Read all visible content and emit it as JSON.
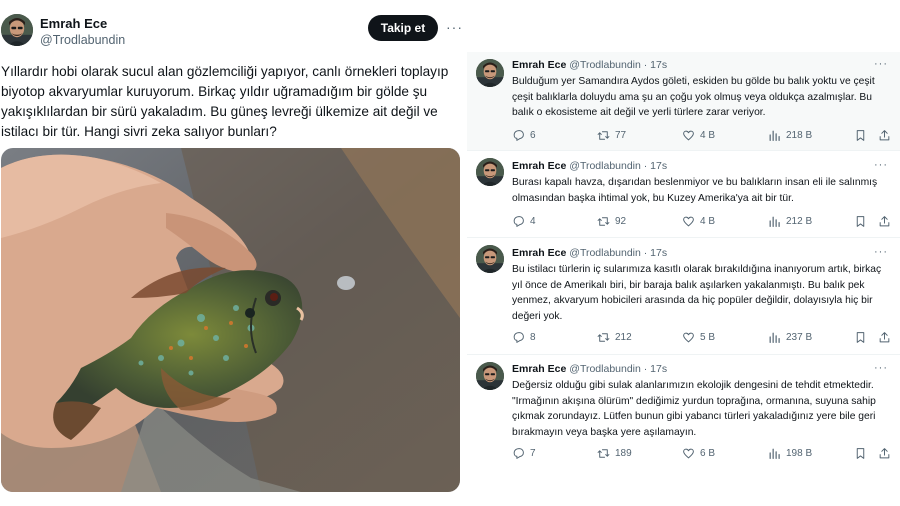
{
  "main_tweet": {
    "name": "Emrah Ece",
    "handle": "@Trodlabundin",
    "follow_label": "Takip et",
    "more": "···",
    "text": "Yıllardır hobi olarak sucul alan gözlemciliği yapıyor, canlı örnekleri toplayıp biyotop akvaryumlar kuruyorum. Birkaç yıldır uğramadığım bir gölde şu yakışıklılardan bir sürü yakaladım. Bu güneş levreği ülkemize ait değil ve istilacı bir tür. Hangi sivri zeka salıyor bunları?"
  },
  "replies": [
    {
      "name": "Emrah Ece",
      "handle": "@Trodlabundin",
      "time": "· 17s",
      "text": "Bulduğum yer Samandıra Aydos göleti, eskiden bu gölde bu balık yoktu ve çeşit çeşit balıklarla doluydu ama şu an çoğu yok olmuş veya oldukça azalmışlar. Bu balık o ekosisteme ait değil ve yerli türlere zarar veriyor.",
      "replies": "6",
      "retweets": "77",
      "likes": "4 B",
      "views": "218 B"
    },
    {
      "name": "Emrah Ece",
      "handle": "@Trodlabundin",
      "time": "· 17s",
      "text": "Burası kapalı havza, dışarıdan beslenmiyor ve bu balıkların insan eli ile salınmış olmasından başka ihtimal yok, bu Kuzey Amerika'ya ait bir tür.",
      "replies": "4",
      "retweets": "92",
      "likes": "4 B",
      "views": "212 B"
    },
    {
      "name": "Emrah Ece",
      "handle": "@Trodlabundin",
      "time": "· 17s",
      "text": "Bu istilacı türlerin iç sularımıza kasıtlı olarak bırakıldığına inanıyorum artık, birkaç yıl önce de Amerikalı biri, bir baraja balık aşılarken yakalanmıştı. Bu balık pek yenmez, akvaryum hobicileri arasında da hiç popüler değildir, dolayısıyla hiç bir değeri yok.",
      "replies": "8",
      "retweets": "212",
      "likes": "5 B",
      "views": "237 B"
    },
    {
      "name": "Emrah Ece",
      "handle": "@Trodlabundin",
      "time": "· 17s",
      "text": "Değersiz olduğu gibi sulak alanlarımızın ekolojik dengesini de tehdit etmektedir. \"Irmağının akışına ölürüm\" dediğimiz yurdun toprağına, ormanına, suyuna sahip çıkmak zorundayız. Lütfen bunun gibi yabancı türleri yakaladığınız yere bile geri bırakmayın veya başka yere aşılamayın.",
      "replies": "7",
      "retweets": "189",
      "likes": "6 B",
      "views": "198 B"
    }
  ]
}
